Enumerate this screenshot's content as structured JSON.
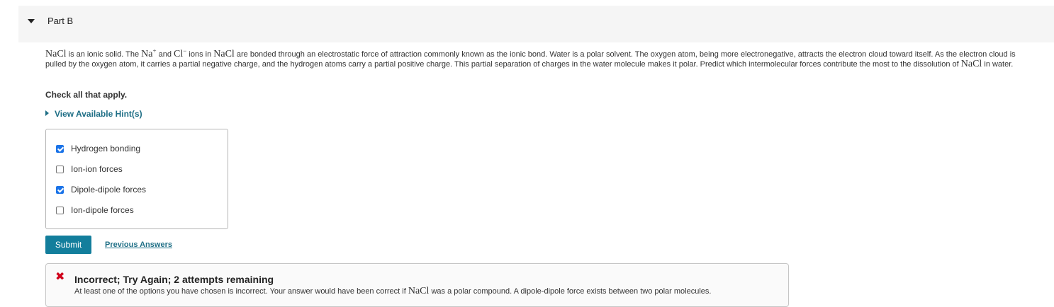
{
  "part": {
    "title": "Part B"
  },
  "question": {
    "seg1": "NaCl",
    "seg2": " is an ionic solid. The ",
    "seg3": "Na",
    "seg3sup": "+",
    "seg4": "  and ",
    "seg5": "Cl",
    "seg5sup": "−",
    "seg6": "  ions in ",
    "seg7": "NaCl",
    "seg8": " are bonded through an electrostatic force of attraction commonly known as the ionic bond. Water is a polar solvent. The oxygen atom, being more electronegative, attracts the electron cloud  toward itself. As the electron cloud is pulled by the oxygen atom, it carries a partial negative charge, and the hydrogen atoms carry a partial positive charge. This partial separation of charges in the water molecule makes it polar. Predict which intermolecular forces contribute the most to the dissolution of ",
    "seg9": "NaCl",
    "seg10": " in water."
  },
  "instructions": "Check all that apply.",
  "hint_label": "View Available Hint(s)",
  "options": [
    {
      "label": "Hydrogen bonding",
      "checked": true
    },
    {
      "label": "Ion-ion forces",
      "checked": false
    },
    {
      "label": "Dipole-dipole forces",
      "checked": true
    },
    {
      "label": "Ion-dipole forces",
      "checked": false
    }
  ],
  "submit_label": "Submit",
  "previous_answers_label": "Previous Answers",
  "feedback": {
    "title": "Incorrect; Try Again; 2 attempts remaining",
    "text_a": "At least one of the options you have chosen is incorrect. Your answer would have been correct if ",
    "text_b": "NaCl",
    "text_c": " was a polar compound. A dipole-dipole force exists between two polar molecules."
  }
}
